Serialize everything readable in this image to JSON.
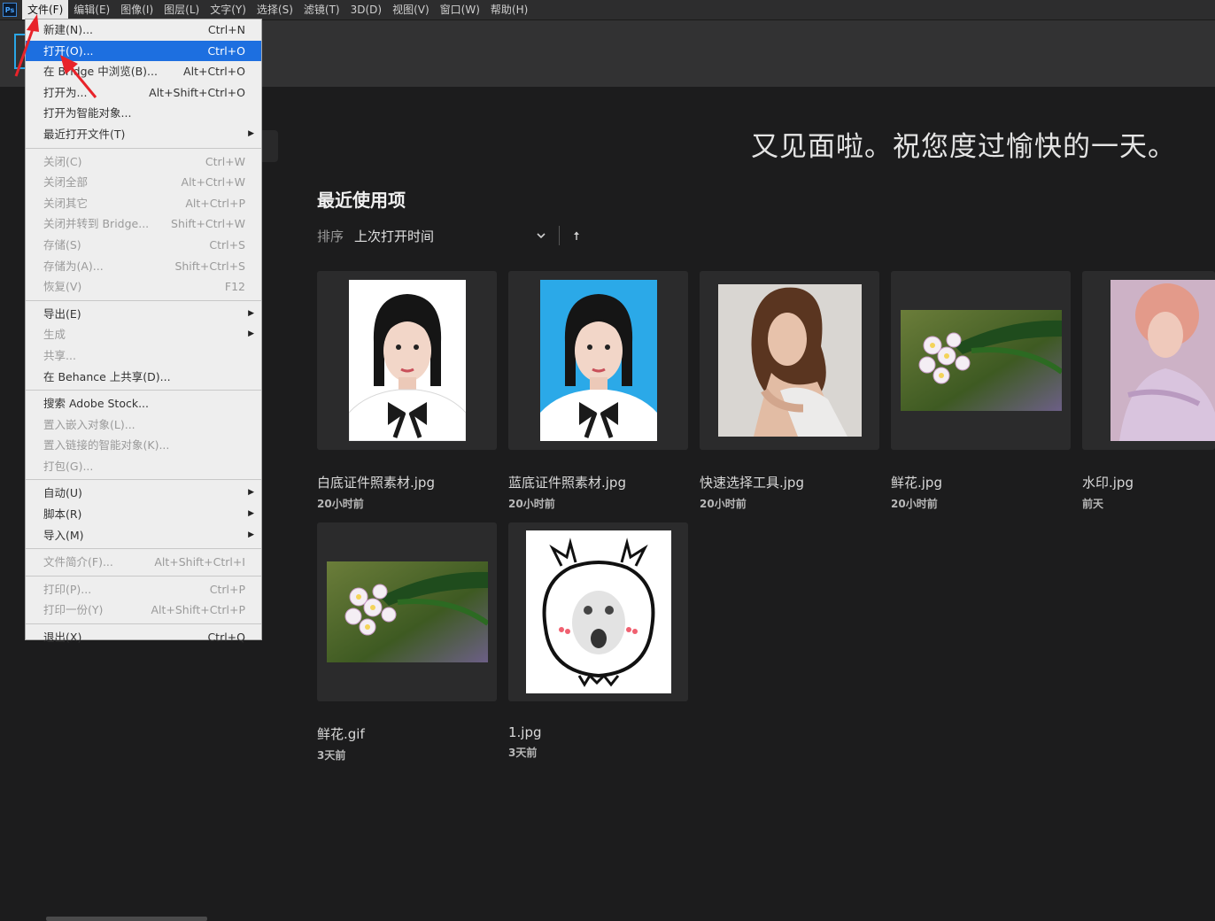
{
  "menubar": {
    "logo": "Ps",
    "items": [
      "文件(F)",
      "编辑(E)",
      "图像(I)",
      "图层(L)",
      "文字(Y)",
      "选择(S)",
      "滤镜(T)",
      "3D(D)",
      "视图(V)",
      "窗口(W)",
      "帮助(H)"
    ]
  },
  "file_menu": {
    "items": [
      {
        "label": "新建(N)...",
        "shortcut": "Ctrl+N"
      },
      {
        "label": "打开(O)...",
        "shortcut": "Ctrl+O"
      },
      {
        "label": "在 Bridge 中浏览(B)...",
        "shortcut": "Alt+Ctrl+O"
      },
      {
        "label": "打开为...",
        "shortcut": "Alt+Shift+Ctrl+O"
      },
      {
        "label": "打开为智能对象..."
      },
      {
        "label": "最近打开文件(T)"
      },
      {
        "label": "关闭(C)",
        "shortcut": "Ctrl+W"
      },
      {
        "label": "关闭全部",
        "shortcut": "Alt+Ctrl+W"
      },
      {
        "label": "关闭其它",
        "shortcut": "Alt+Ctrl+P"
      },
      {
        "label": "关闭并转到 Bridge...",
        "shortcut": "Shift+Ctrl+W"
      },
      {
        "label": "存储(S)",
        "shortcut": "Ctrl+S"
      },
      {
        "label": "存储为(A)...",
        "shortcut": "Shift+Ctrl+S"
      },
      {
        "label": "恢复(V)",
        "shortcut": "F12"
      },
      {
        "label": "导出(E)"
      },
      {
        "label": "生成"
      },
      {
        "label": "共享..."
      },
      {
        "label": "在 Behance 上共享(D)..."
      },
      {
        "label": "搜索 Adobe Stock..."
      },
      {
        "label": "置入嵌入对象(L)..."
      },
      {
        "label": "置入链接的智能对象(K)..."
      },
      {
        "label": "打包(G)..."
      },
      {
        "label": "自动(U)"
      },
      {
        "label": "脚本(R)"
      },
      {
        "label": "导入(M)"
      },
      {
        "label": "文件简介(F)...",
        "shortcut": "Alt+Shift+Ctrl+I"
      },
      {
        "label": "打印(P)...",
        "shortcut": "Ctrl+P"
      },
      {
        "label": "打印一份(Y)",
        "shortcut": "Alt+Shift+Ctrl+P"
      },
      {
        "label": "退出(X)",
        "shortcut": "Ctrl+Q"
      }
    ]
  },
  "home": {
    "greeting": "又见面啦。祝您度过愉快的一天。",
    "recent_title": "最近使用项",
    "sort_label": "排序",
    "sort_value": "上次打开时间",
    "files": [
      {
        "name": "白底证件照素材.jpg",
        "time": "20小时前"
      },
      {
        "name": "蓝底证件照素材.jpg",
        "time": "20小时前"
      },
      {
        "name": "快速选择工具.jpg",
        "time": "20小时前"
      },
      {
        "name": "鲜花.jpg",
        "time": "20小时前"
      },
      {
        "name": "水印.jpg",
        "time": "前天"
      },
      {
        "name": "鲜花.gif",
        "time": "3天前"
      },
      {
        "name": "1.jpg",
        "time": "3天前"
      }
    ]
  },
  "colors": {
    "highlight": "#1d6fe0",
    "annotation": "#e8232a",
    "background": "#1c1c1d"
  }
}
